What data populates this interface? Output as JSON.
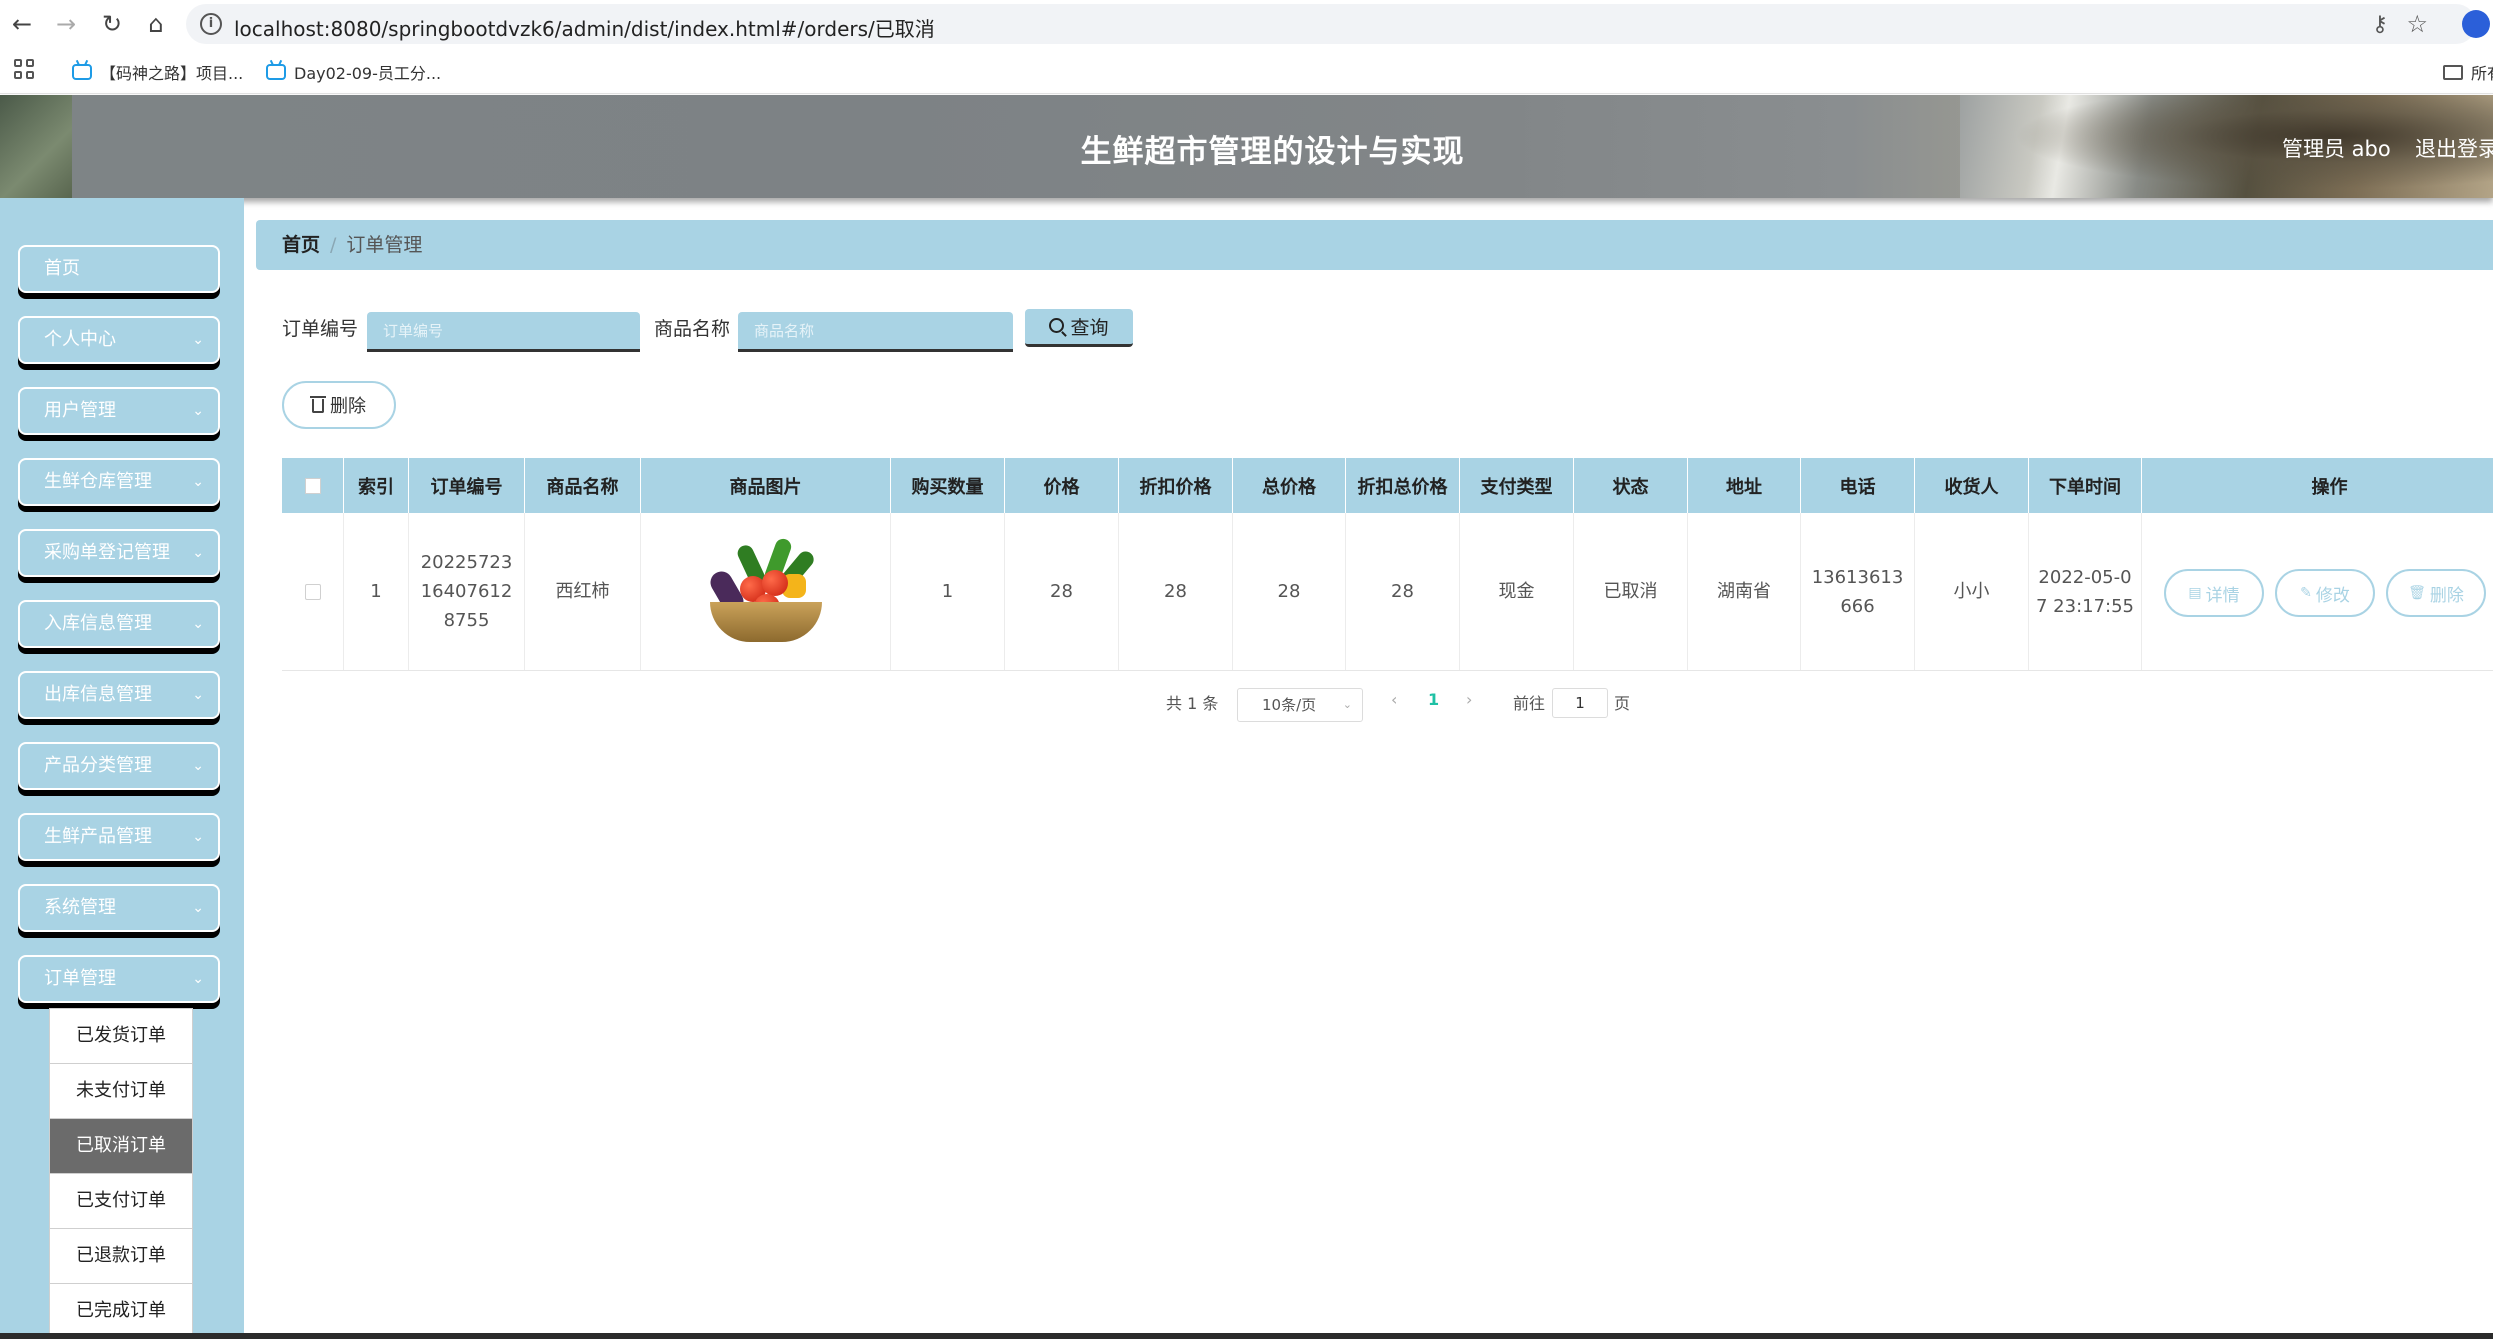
{
  "browser": {
    "url": "localhost:8080/springbootdvzk6/admin/dist/index.html#/orders/已取消",
    "bookmarks": [
      "【码神之路】项目...",
      "Day02-09-员工分..."
    ],
    "folder_label": "所有"
  },
  "header": {
    "title": "生鲜超市管理的设计与实现",
    "user": "管理员 abo",
    "logout": "退出登录"
  },
  "sidebar": {
    "items": [
      {
        "label": "首页",
        "has_children": false
      },
      {
        "label": "个人中心",
        "has_children": true
      },
      {
        "label": "用户管理",
        "has_children": true
      },
      {
        "label": "生鲜仓库管理",
        "has_children": true
      },
      {
        "label": "采购单登记管理",
        "has_children": true
      },
      {
        "label": "入库信息管理",
        "has_children": true
      },
      {
        "label": "出库信息管理",
        "has_children": true
      },
      {
        "label": "产品分类管理",
        "has_children": true
      },
      {
        "label": "生鲜产品管理",
        "has_children": true
      },
      {
        "label": "系统管理",
        "has_children": true
      },
      {
        "label": "订单管理",
        "has_children": true
      }
    ],
    "sub_items": [
      "已发货订单",
      "未支付订单",
      "已取消订单",
      "已支付订单",
      "已退款订单",
      "已完成订单"
    ],
    "active_sub": "已取消订单"
  },
  "breadcrumb": {
    "home": "首页",
    "current": "订单管理"
  },
  "search": {
    "order_no_label": "订单编号",
    "order_no_placeholder": "订单编号",
    "product_label": "商品名称",
    "product_placeholder": "商品名称",
    "query_button": "查询"
  },
  "toolbar": {
    "delete_label": "删除"
  },
  "table": {
    "columns": [
      "索引",
      "订单编号",
      "商品名称",
      "商品图片",
      "购买数量",
      "价格",
      "折扣价格",
      "总价格",
      "折扣总价格",
      "支付类型",
      "状态",
      "地址",
      "电话",
      "收货人",
      "下单时间",
      "操作"
    ],
    "rows": [
      {
        "index": "1",
        "order_no": [
          "20225723",
          "16407612",
          "8755"
        ],
        "product": "西红柿",
        "image": "vegetable-basket",
        "quantity": "1",
        "price": "28",
        "discount_price": "28",
        "total": "28",
        "discount_total": "28",
        "pay_type": "现金",
        "status": "已取消",
        "address": "湖南省",
        "phone": [
          "13613613",
          "666"
        ],
        "receiver": "小小",
        "time": [
          "2022-05-0",
          "7 23:17:55"
        ]
      }
    ],
    "actions": [
      "详情",
      "修改",
      "删除"
    ]
  },
  "pagination": {
    "total": "共 1 条",
    "page_size": "10条/页",
    "current_page": "1",
    "goto_label": "前往",
    "goto_value": "1",
    "page_unit": "页"
  },
  "colors": {
    "theme": "#a9d3e4",
    "active_page": "#1fc1a5",
    "active_sub_bg": "#6b6b6b"
  }
}
